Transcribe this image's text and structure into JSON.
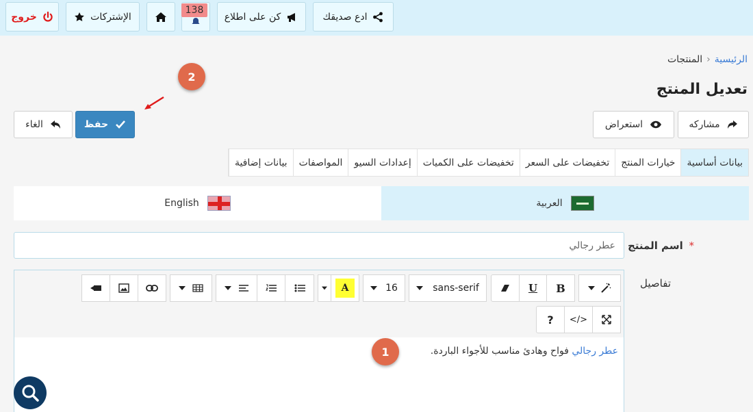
{
  "topbar": {
    "logout_label": "خروج",
    "subscriptions_label": "الإشتركات",
    "notifications_count": "138",
    "stay_informed_label": "كن على اطلاع",
    "invite_friend_label": "ادع صديقك"
  },
  "breadcrumb": {
    "home": "الرئيسية",
    "separator": "‹",
    "current": "المنتجات"
  },
  "page": {
    "title": "تعديل المنتج"
  },
  "steps": {
    "one": "1",
    "two": "2"
  },
  "actions": {
    "share_label": "مشاركه",
    "preview_label": "استعراض",
    "save_label": "حفظ",
    "cancel_label": "الغاء"
  },
  "tabs": [
    {
      "label": "بيانات أساسية"
    },
    {
      "label": "خيارات المنتج"
    },
    {
      "label": "تخفيضات على السعر"
    },
    {
      "label": "تخفيضات على الكميات"
    },
    {
      "label": "إعدادات السيو"
    },
    {
      "label": "المواصفات"
    },
    {
      "label": "بيانات إضافية"
    }
  ],
  "languages": {
    "arabic": "العربية",
    "english": "English"
  },
  "form": {
    "name_label": "اسم المنتج",
    "required_mark": "*",
    "name_value": "عطر رجالي",
    "details_label": "تفاصيل"
  },
  "editor": {
    "font_family": "sans-serif",
    "font_size": "16",
    "bold": "B",
    "underline": "U",
    "highlight": "A",
    "help": "?",
    "code": "</>",
    "content_link": "عطر رجالي",
    "content_text": " فواح وهادئ مناسب للأجواء الباردة."
  },
  "colors": {
    "accent": "#3a87c0",
    "topbar": "#d9f1fb",
    "step_badge": "#e06a4b",
    "logout": "#e01b1b"
  }
}
